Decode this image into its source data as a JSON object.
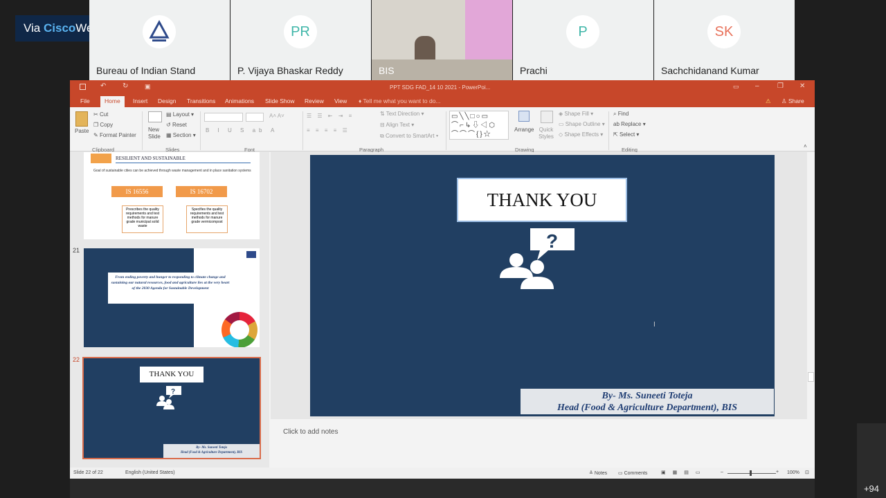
{
  "webex": {
    "prefix": "Via ",
    "brand1": "Cisco",
    "brand2": "Webex"
  },
  "participants": [
    {
      "initials": "",
      "name": "Bureau of Indian Stand",
      "color": "#2e4a8a"
    },
    {
      "initials": "PR",
      "name": "P. Vijaya Bhaskar Reddy",
      "color": "#3fb6a8"
    },
    {
      "initials": "",
      "name": "BIS",
      "color": "#fff"
    },
    {
      "initials": "P",
      "name": "Prachi",
      "color": "#3fb6a8"
    },
    {
      "initials": "SK",
      "name": "Sachchidanand Kumar",
      "color": "#e8715a"
    }
  ],
  "more_participants": "+94",
  "ppt": {
    "title": "PPT SDG FAD_14 10 2021  -  PowerPoi...",
    "tabs": [
      "File",
      "Home",
      "Insert",
      "Design",
      "Transitions",
      "Animations",
      "Slide Show",
      "Review",
      "View"
    ],
    "tell_me": "Tell me what you want to do...",
    "share": "Share",
    "ribbon": {
      "paste": "Paste",
      "cut": "Cut",
      "copy": "Copy",
      "format_painter": "Format Painter",
      "new_slide": "New Slide",
      "layout": "Layout",
      "reset": "Reset",
      "section": "Section",
      "text_direction": "Text Direction",
      "align_text": "Align Text",
      "convert_smartart": "Convert to SmartArt",
      "arrange": "Arrange",
      "quick_styles": "Quick Styles",
      "shape_fill": "Shape Fill",
      "shape_outline": "Shape Outline",
      "shape_effects": "Shape Effects",
      "find": "Find",
      "replace": "Replace",
      "select": "Select",
      "groups": [
        "Clipboard",
        "Slides",
        "Font",
        "Paragraph",
        "Drawing",
        "Editing"
      ]
    },
    "thumbs": {
      "t20_heading": "RESILIENT AND SUSTAINABLE",
      "t20_bullet": "Goal of sustainable cities can be achieved through waste management and in place sanitation systems",
      "t20_box1": "IS 16556",
      "t20_box2": "IS 16702",
      "t20_desc1": "Prescribes the quality requirements and test methods for manure grade municipal solid waste",
      "t20_desc2": "Specifies the quality requirements and test methods for manure grade vermicompost",
      "t21_num": "21",
      "t21_quote": "From ending poverty and hunger to responding to climate change and sustaining our natural resources, food and agriculture lies at the very heart of the 2030 Agenda for Sustainable Development",
      "t22_num": "22"
    },
    "slide": {
      "title": "THANK YOU",
      "author_line1": "By- Ms. Suneeti Toteja",
      "author_line2": "Head (Food & Agriculture Department), BIS"
    },
    "notes_placeholder": "Click to add notes",
    "status": {
      "slide": "Slide 22 of 22",
      "language": "English (United States)",
      "notes": "Notes",
      "comments": "Comments",
      "zoom": "100%"
    }
  }
}
